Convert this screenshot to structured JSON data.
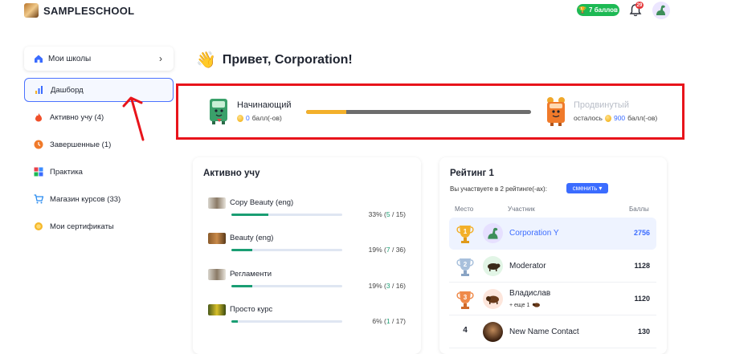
{
  "header": {
    "brand": "SAMPLESCHOOL",
    "points_badge": "7 баллов",
    "notifications_count": "29"
  },
  "sidebar": {
    "school_select": "Мои школы",
    "items": [
      {
        "label": "Дашборд",
        "icon": "chart-icon",
        "active": true
      },
      {
        "label": "Активно учу (4)",
        "icon": "flame-icon",
        "active": false
      },
      {
        "label": "Завершенные (1)",
        "icon": "clock-icon",
        "active": false
      },
      {
        "label": "Практика",
        "icon": "grid-icon",
        "active": false
      },
      {
        "label": "Магазин курсов (33)",
        "icon": "cart-icon",
        "active": false
      },
      {
        "label": "Мои сертификаты",
        "icon": "medal-icon",
        "active": false
      }
    ]
  },
  "greeting": {
    "emoji": "👋",
    "text": "Привет, Corporation!"
  },
  "level": {
    "current_name": "Начинающий",
    "current_points": "0",
    "points_unit": "балл(-ов)",
    "next_name": "Продвинутый",
    "remaining_label": "осталось",
    "remaining_points": "900",
    "progress_fraction": 0.18
  },
  "learning": {
    "title": "Активно учу",
    "courses": [
      {
        "name": "Copy Beauty (eng)",
        "percent": "33%",
        "done": "5",
        "total": "15",
        "fraction": 0.33
      },
      {
        "name": "Beauty (eng)",
        "percent": "19%",
        "done": "7",
        "total": "36",
        "fraction": 0.19
      },
      {
        "name": "Регламенти",
        "percent": "19%",
        "done": "3",
        "total": "16",
        "fraction": 0.19
      },
      {
        "name": "Просто курс",
        "percent": "6%",
        "done": "1",
        "total": "17",
        "fraction": 0.06
      }
    ]
  },
  "rating": {
    "title": "Рейтинг 1",
    "subtitle": "Вы участвуете в 2 рейтинге(-ах):",
    "change_label": "сменить",
    "col_place": "Место",
    "col_participant": "Участник",
    "col_points": "Баллы",
    "rows": [
      {
        "rank": "1",
        "name": "Corporation Y",
        "score": "2756",
        "me": true,
        "extra": ""
      },
      {
        "rank": "2",
        "name": "Moderator",
        "score": "1128",
        "me": false,
        "extra": ""
      },
      {
        "rank": "3",
        "name": "Владислав",
        "score": "1120",
        "me": false,
        "extra": "+ еще 1"
      },
      {
        "rank": "4",
        "name": "New Name Contact",
        "score": "130",
        "me": false,
        "extra": ""
      }
    ]
  },
  "colors": {
    "accent": "#3b6cff",
    "progress_yellow": "#f3b02a",
    "course_green": "#1a9e73",
    "highlight_red": "#e8141b",
    "badge_green": "#1db954"
  }
}
